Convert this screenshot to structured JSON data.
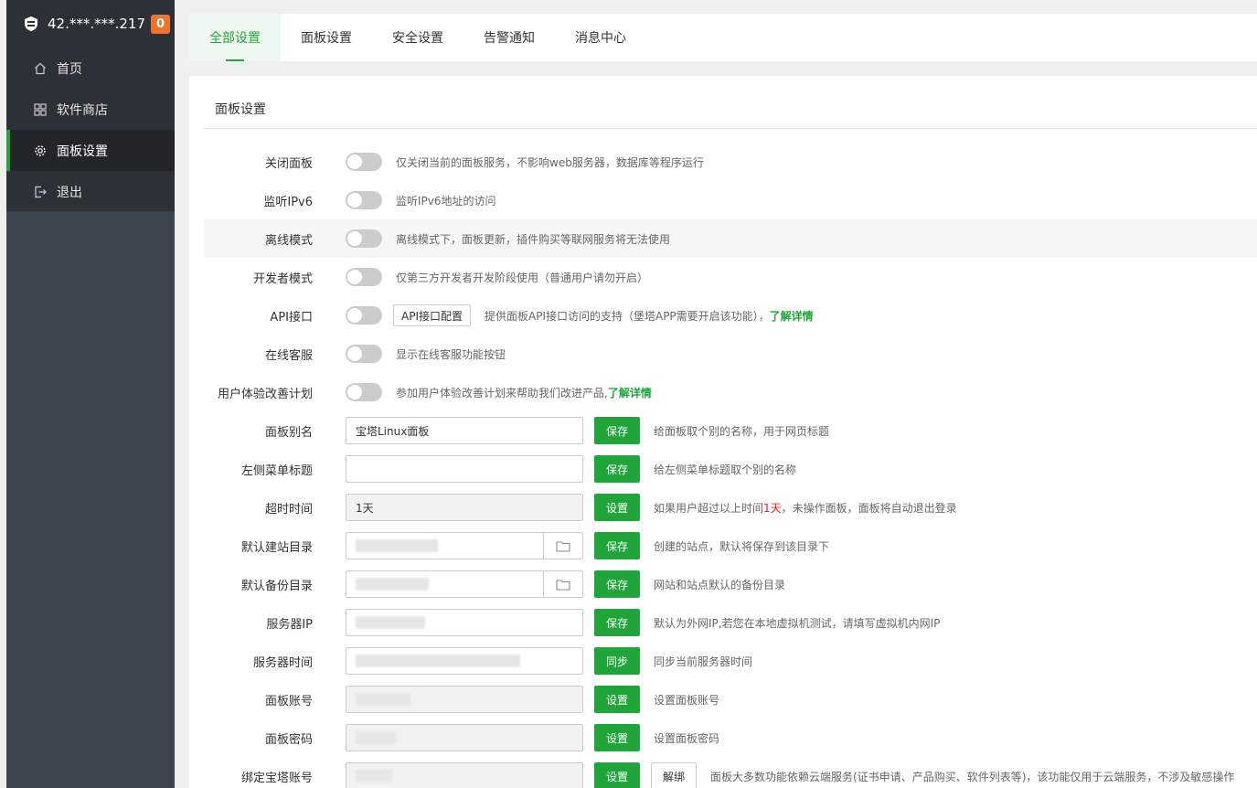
{
  "sidebar": {
    "server_ip": "42.***.***.217",
    "badge": "0",
    "items": [
      {
        "label": "首页"
      },
      {
        "label": "软件商店"
      },
      {
        "label": "面板设置"
      },
      {
        "label": "退出"
      }
    ]
  },
  "tabs": [
    {
      "label": "全部设置"
    },
    {
      "label": "面板设置"
    },
    {
      "label": "安全设置"
    },
    {
      "label": "告警通知"
    },
    {
      "label": "消息中心"
    }
  ],
  "panel": {
    "title": "面板设置",
    "rows": {
      "close_panel": {
        "label": "关闭面板",
        "desc": "仅关闭当前的面板服务，不影响web服务器，数据库等程序运行"
      },
      "ipv6": {
        "label": "监听IPv6",
        "desc": "监听IPv6地址的访问"
      },
      "offline": {
        "label": "离线模式",
        "desc": "离线模式下，面板更新，插件购买等联网服务将无法使用"
      },
      "developer": {
        "label": "开发者模式",
        "desc": "仅第三方开发者开发阶段使用（普通用户请勿开启）"
      },
      "api": {
        "label": "API接口",
        "config_button": "API接口配置",
        "desc": "提供面板API接口访问的支持（堡塔APP需要开启该功能），",
        "link": "了解详情"
      },
      "online_service": {
        "label": "在线客服",
        "desc": "显示在线客服功能按钮"
      },
      "ux_plan": {
        "label": "用户体验改善计划",
        "desc": "参加用户体验改善计划来帮助我们改进产品,",
        "link": "了解详情"
      },
      "alias": {
        "label": "面板别名",
        "value": "宝塔Linux面板",
        "button": "保存",
        "desc": "给面板取个别的名称，用于网页标题"
      },
      "menu_title": {
        "label": "左侧菜单标题",
        "value": "",
        "button": "保存",
        "desc": "给左侧菜单标题取个别的名称"
      },
      "timeout": {
        "label": "超时时间",
        "value": "1天",
        "button": "设置",
        "desc_prefix": "如果用户超过以上时间",
        "desc_highlight": "1天",
        "desc_suffix": "，未操作面板，面板将自动退出登录"
      },
      "site_dir": {
        "label": "默认建站目录",
        "button": "保存",
        "desc": "创建的站点，默认将保存到该目录下"
      },
      "backup_dir": {
        "label": "默认备份目录",
        "button": "保存",
        "desc": "网站和站点默认的备份目录"
      },
      "server_ip": {
        "label": "服务器IP",
        "button": "保存",
        "desc": "默认为外网IP,若您在本地虚拟机测试，请填写虚拟机内网IP"
      },
      "server_time": {
        "label": "服务器时间",
        "button": "同步",
        "desc": "同步当前服务器时间"
      },
      "account": {
        "label": "面板账号",
        "button": "设置",
        "desc": "设置面板账号"
      },
      "password": {
        "label": "面板密码",
        "button": "设置",
        "desc": "设置面板密码"
      },
      "bind_account": {
        "label": "绑定宝塔账号",
        "button": "设置",
        "unbind_button": "解绑",
        "desc": "面板大多数功能依赖云端服务(证书申请、产品购买、软件列表等)，该功能仅用于云端服务，不涉及敏感操作"
      }
    }
  }
}
